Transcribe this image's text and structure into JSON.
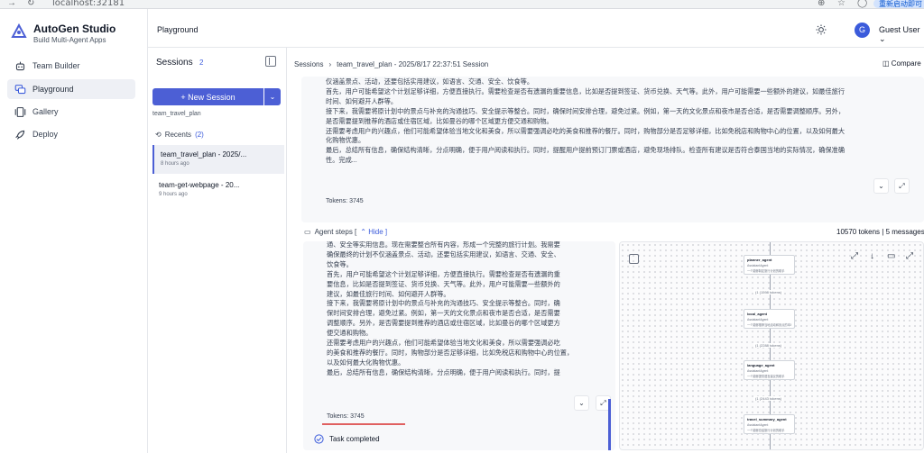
{
  "browser": {
    "url": "localhost:32181",
    "ext_label": "重新启动即可"
  },
  "app": {
    "title": "AutoGen Studio",
    "subtitle": "Build Multi-Agent Apps"
  },
  "nav": [
    {
      "label": "Team Builder",
      "icon": "robot-icon"
    },
    {
      "label": "Playground",
      "icon": "chat-icon"
    },
    {
      "label": "Gallery",
      "icon": "gallery-icon"
    },
    {
      "label": "Deploy",
      "icon": "rocket-icon"
    }
  ],
  "header": {
    "title": "Playground",
    "user": "Guest User",
    "avatar_letter": "G"
  },
  "sessions": {
    "title": "Sessions",
    "count": "2",
    "new_label": "+ New Session",
    "sub": "team_travel_plan",
    "recents_label": "Recents",
    "recents_count": "(2)",
    "items": [
      {
        "name": "team_travel_plan - 2025/...",
        "time": "8 hours ago"
      },
      {
        "name": "team-get-webpage - 20...",
        "time": "9 hours ago"
      }
    ]
  },
  "main": {
    "crumb_root": "Sessions",
    "crumb_sep": "›",
    "crumb_current": "team_travel_plan - 2025/8/17 22:37:51 Session",
    "compare_label": "Compare",
    "message_lines": [
      "仅涵盖景点、活动，还要包括实用建议，如语言、交通、安全、饮食等。",
      "首先，用户可能希望这个计划足够详细，方便直接执行。需要检查是否有遗漏的重要信息，比如是否提到签证、货币兑换、天气等。此外，用户可能需要一些额外的建议，如最佳旅行",
      "时间、如何避开人群等。",
      "接下来，我需要将原计划中的景点与补充的沟通技巧、安全提示等整合。同时，确保时间安排合理，避免过紧。例如，第一天的文化景点和夜市是否合适，是否需要调整顺序。另外，",
      "是否需要提到推荐的酒店或住宿区域，比如曼谷的哪个区域更方便交通和购物。",
      "还需要考虑用户的兴趣点，他们可能希望体验当地文化和美食，所以需要强调必吃的美食和推荐的餐厅。同时，购物部分是否足够详细，比如免税店和购物中心的位置，以及如何最大",
      "化购物优惠。",
      "最后，总结所有信息，确保结构清晰，分点明确，便于用户阅读和执行。同时，提醒用户提前预订门票或酒店，避免现场排队。检查所有建议是否符合泰国当地的实际情况，确保准确",
      "性。完成..."
    ],
    "tokens": "Tokens: 3745",
    "agent_steps_label": "Agent steps [",
    "hide_label": "Hide ]",
    "meta": "10570 tokens | 5 messages",
    "step_lines": [
      "通、安全等实用信息。现在需要整合所有内容，形成一个完整的旅行计划。我需要",
      "确保最终的计划不仅涵盖景点、活动，还要包括实用建议，如语言、交通、安全、",
      "饮食等。",
      "首先，用户可能希望这个计划足够详细，方便直接执行。需要检查是否有遗漏的重",
      "要信息，比如是否提到签证、货币兑换、天气等。此外，用户可能需要一些额外的",
      "建议，如最佳旅行时间、如何避开人群等。",
      "接下来，我需要将原计划中的景点与补充的沟通技巧、安全提示等整合。同时，确",
      "保时间安排合理，避免过紧。例如，第一天的文化景点和夜市是否合适，是否需要",
      "调整顺序。另外，是否需要提到推荐的酒店或住宿区域，比如曼谷的哪个区域更方",
      "便交通和购物。",
      "还需要考虑用户的兴趣点，他们可能希望体验当地文化和美食，所以需要强调必吃",
      "的美食和推荐的餐厅。同时，购物部分是否足够详细，比如免税店和购物中心的位置，",
      "以及如何最大化购物优惠。",
      "最后，总结所有信息，确保结构清晰，分点明确，便于用户阅读和执行。同时，提"
    ],
    "step_tokens": "Tokens: 3745",
    "task_completed": "Task completed"
  },
  "graph": {
    "nodes": [
      {
        "name": "planner_agent",
        "type": "AssistantAgent",
        "desc": "一个能够制定旅行计划的助手"
      },
      {
        "name": "local_agent",
        "type": "AssistantAgent",
        "desc": "一个能够推荐当地活动和景点的本地助手"
      },
      {
        "name": "language_agent",
        "type": "AssistantAgent",
        "desc": "一个能够提供语言建议的助手"
      },
      {
        "name": "travel_summary_agent",
        "type": "AssistantAgent",
        "desc": "一个能够总结旅行计划的助手"
      }
    ],
    "edges": [
      "(1 (1598 tokens)",
      "(1 (2288 tokens)",
      "(1 (2443 tokens)"
    ]
  }
}
